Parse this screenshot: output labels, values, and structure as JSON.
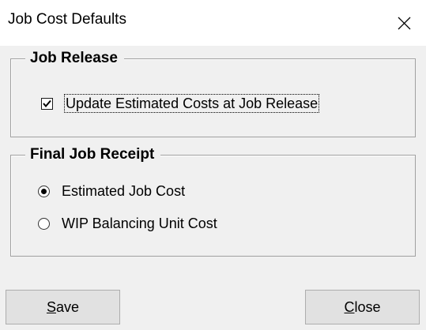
{
  "window": {
    "title": "Job Cost Defaults"
  },
  "job_release": {
    "legend": "Job Release",
    "checkbox_label": "Update Estimated Costs at Job Release",
    "checked": true
  },
  "final_job_receipt": {
    "legend": "Final Job Receipt",
    "options": [
      {
        "label": "Estimated Job Cost",
        "selected": true
      },
      {
        "label": "WIP Balancing Unit Cost",
        "selected": false
      }
    ]
  },
  "buttons": {
    "save_label": "Save",
    "close_label": "Close"
  },
  "icons": {
    "close": "close-icon",
    "checkmark": "checkmark-icon"
  }
}
